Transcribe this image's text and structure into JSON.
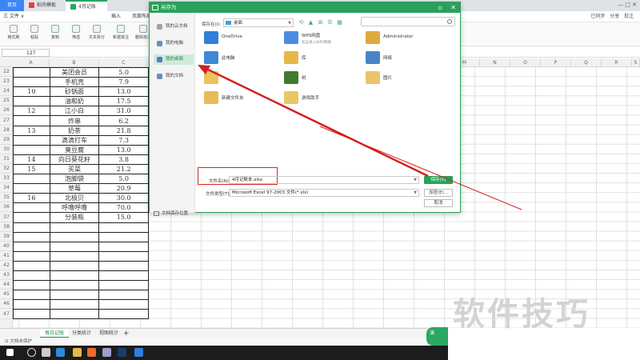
{
  "titlebar": {
    "tabs": [
      {
        "label": "首页"
      },
      {
        "label": "稻壳模板"
      },
      {
        "label": "4月记账本.xlsx"
      }
    ],
    "controls": "—  □  ✕"
  },
  "menubar": {
    "items": [
      "文件",
      "开始",
      "插入",
      "页面布局"
    ],
    "file_menu": "三 文件 ∨",
    "right": [
      "已同步",
      "分享",
      "批注"
    ]
  },
  "ribbon": {
    "buttons": [
      "格式刷",
      "粘贴",
      "复制",
      "筛选",
      "文本拆分",
      "新建批注",
      "删除批注"
    ]
  },
  "formula_bar": {
    "name_box": "127"
  },
  "grid": {
    "columns": [
      "A",
      "B",
      "C",
      "D",
      "E",
      "F",
      "G",
      "H",
      "I",
      "J",
      "K",
      "L",
      "M",
      "N",
      "O",
      "P",
      "Q",
      "R",
      "S"
    ],
    "row_numbers": [
      "22",
      "23",
      "24",
      "25",
      "26",
      "27",
      "28",
      "29",
      "30",
      "31",
      "32",
      "33",
      "34",
      "35",
      "36",
      "37",
      "38",
      "39",
      "40",
      "41",
      "42",
      "43",
      "44",
      "45",
      "46",
      "47"
    ],
    "rows": [
      [
        "",
        "美团会员",
        "5.0"
      ],
      [
        "",
        "手机壳",
        "7.9"
      ],
      [
        "10",
        "砂锅面",
        "13.0"
      ],
      [
        "",
        "油和奶",
        "17.5"
      ],
      [
        "12",
        "江小白",
        "31.0"
      ],
      [
        "",
        "炸串",
        "6.2"
      ],
      [
        "13",
        "奶茶",
        "21.8"
      ],
      [
        "",
        "滴滴打车",
        "7.3"
      ],
      [
        "",
        "臭豆腐",
        "13.0"
      ],
      [
        "14",
        "向日葵花籽",
        "3.8"
      ],
      [
        "15",
        "买菜",
        "21.2"
      ],
      [
        "",
        "泡脚袋",
        "5.0"
      ],
      [
        "",
        "草莓",
        "20.9"
      ],
      [
        "16",
        "北极贝",
        "30.0"
      ],
      [
        "",
        "呼噜呼噜",
        "70.0"
      ],
      [
        "",
        "分装瓶",
        "15.0"
      ],
      [
        "",
        "",
        ""
      ],
      [
        "",
        "",
        ""
      ],
      [
        "",
        "",
        ""
      ],
      [
        "",
        "",
        ""
      ],
      [
        "",
        "",
        ""
      ],
      [
        "",
        "",
        ""
      ],
      [
        "",
        "",
        ""
      ],
      [
        "",
        "",
        ""
      ],
      [
        "",
        "",
        ""
      ],
      [
        "",
        "",
        ""
      ]
    ]
  },
  "sheets": [
    {
      "label": "每日记账",
      "active": true
    },
    {
      "label": "分类统计",
      "active": false
    },
    {
      "label": "视图统计",
      "active": false
    }
  ],
  "add_sheet": "+",
  "status": "文档未保护",
  "watermark": "软件技巧",
  "float_button": "演",
  "dialog": {
    "title": "另存为",
    "sidebar": [
      {
        "label": "我的云文档",
        "color": "#9aa4ad"
      },
      {
        "label": "我的电脑",
        "color": "#6b8fb8"
      },
      {
        "label": "我的桌面",
        "color": "#4a7fc6",
        "active": true
      },
      {
        "label": "我的文档",
        "color": "#6b8fb8"
      }
    ],
    "location_link": "文档保存位置",
    "save_in_label": "保存在(I):",
    "save_in_value": "桌面",
    "tools": [
      "⟲",
      "▲",
      "⊞",
      "☰",
      "▦"
    ],
    "files": [
      {
        "name": "OneDrive",
        "color": "#2f80d6",
        "col": 0,
        "row": 0
      },
      {
        "name": "WPS网盘",
        "sub": "双击进入WPS网盘",
        "color": "#4d8be0",
        "col": 1,
        "row": 0
      },
      {
        "name": "Administrator",
        "color": "#e0a93d",
        "col": 2,
        "row": 0
      },
      {
        "name": "此电脑",
        "color": "#3d8ad6",
        "col": 0,
        "row": 1
      },
      {
        "name": "库",
        "color": "#e6b84a",
        "col": 1,
        "row": 1
      },
      {
        "name": "网络",
        "color": "#4a84c4",
        "col": 2,
        "row": 1
      },
      {
        "name": "",
        "color": "#e8c35e",
        "col": 0,
        "row": 2
      },
      {
        "name": "树",
        "color": "#3f7a32",
        "col": 1,
        "row": 2
      },
      {
        "name": "图片",
        "color": "#eac46a",
        "col": 2,
        "row": 2
      },
      {
        "name": "新建文件夹",
        "color": "#e6bd55",
        "col": 0,
        "row": 3
      },
      {
        "name": "游戏助手",
        "color": "#e9c766",
        "col": 1,
        "row": 3
      }
    ],
    "file_name_label": "文件名(N):",
    "file_name_value": "4月记账本.xlsx",
    "file_type_label": "文件类型(T):",
    "file_type_value": "Microsoft Excel 97-2003 文件(*.xls)",
    "save_button": "保存(S)",
    "encrypt_button": "加密(E)...",
    "cancel_button": "取消"
  },
  "taskbar_icons": [
    {
      "name": "windows-logo-icon",
      "color": "#ffffff"
    },
    {
      "name": "search-icon",
      "color": "#dddddd"
    },
    {
      "name": "taskview-icon",
      "color": "#cccccc"
    },
    {
      "name": "edge-icon",
      "color": "#2e8bd9"
    },
    {
      "name": "explorer-icon",
      "color": "#e4b94a"
    },
    {
      "name": "media-icon",
      "color": "#ee6a2a"
    },
    {
      "name": "app-icon",
      "color": "#9aa0c8"
    },
    {
      "name": "photoshop-icon",
      "color": "#1a3d6b"
    },
    {
      "name": "wps-icon",
      "color": "#2f7fe0"
    }
  ],
  "colors": {
    "accent": "#2aa15a",
    "annotation": "#d22222",
    "home_tab": "#3b86f5"
  }
}
